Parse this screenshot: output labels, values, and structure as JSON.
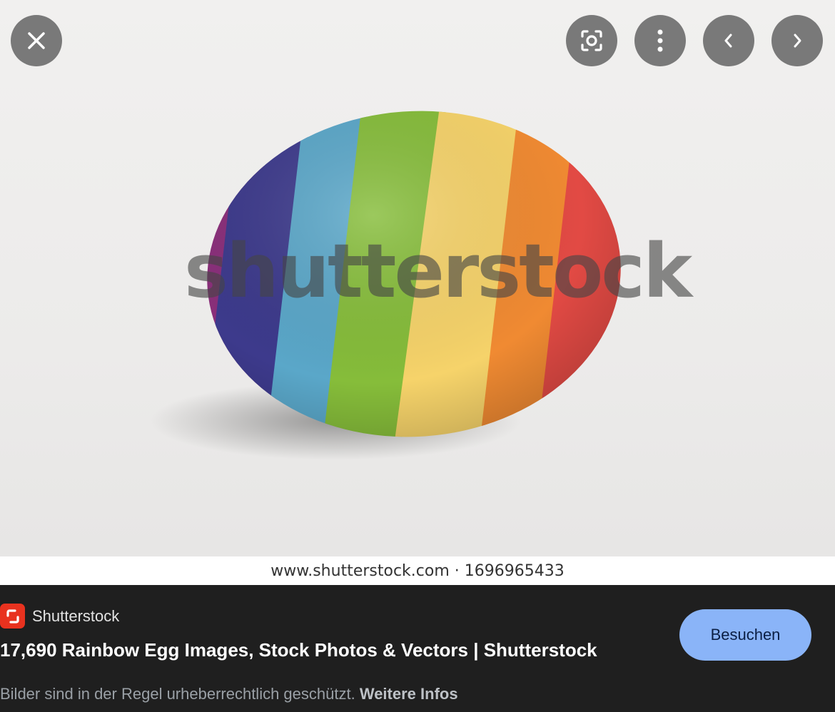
{
  "image": {
    "watermark": "shutterstock",
    "caption": "www.shutterstock.com · 1696965433"
  },
  "controls": {
    "close": "close-icon",
    "lens": "lens-search-icon",
    "more": "more-vert-icon",
    "prev": "chevron-left-icon",
    "next": "chevron-right-icon"
  },
  "result": {
    "source_name": "Shutterstock",
    "title": "17,690 Rainbow Egg Images, Stock Photos & Vectors | Shutterstock",
    "visit_label": "Besuchen",
    "copyright_text": "Bilder sind in der Regel urheberrechtlich geschützt.",
    "more_info": "Weitere Infos"
  },
  "colors": {
    "accent": "#8ab4f8",
    "brand": "#e8321f",
    "background": "#1f1f1f"
  }
}
